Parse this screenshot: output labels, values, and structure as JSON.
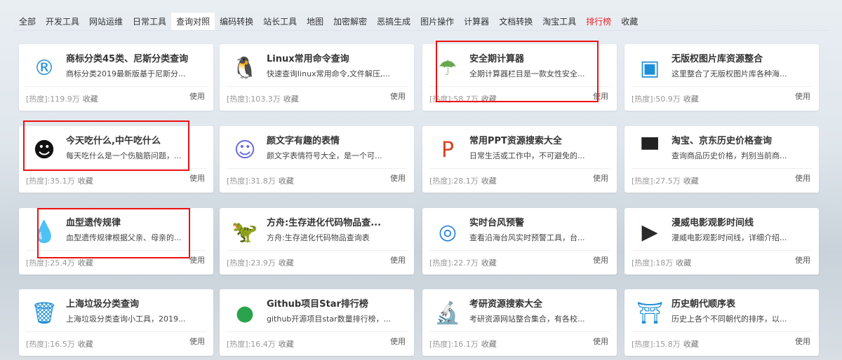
{
  "tabs": [
    "全部",
    "开发工具",
    "网站运维",
    "日常工具",
    "查询对照",
    "编码转换",
    "站长工具",
    "地图",
    "加密解密",
    "恶搞生成",
    "图片操作",
    "计算器",
    "文档转换",
    "淘宝工具",
    "排行榜",
    "收藏"
  ],
  "active_tab": "查询对照",
  "hot_tab": "排行榜",
  "heat_label": "[热度]:",
  "fav_label": "收藏",
  "use_label": "使用",
  "cards": [
    {
      "title": "商标分类45类、尼斯分类查询",
      "desc": "商标分类2019最新版基于尼斯分...",
      "heat": "119.9万",
      "icon": "registered-icon"
    },
    {
      "title": "Linux常用命令查询",
      "desc": "快速查询linux常用命令,文件解压,...",
      "heat": "103.3万",
      "icon": "penguin-icon"
    },
    {
      "title": "安全期计算器",
      "desc": "全期计算器栏目是一款女性安全...",
      "heat": "58.7万",
      "icon": "umbrella-icon"
    },
    {
      "title": "无版权图片库资源整合",
      "desc": "这里整合了无版权图片库各种海...",
      "heat": "50.9万",
      "icon": "image-icon"
    },
    {
      "title": "今天吃什么,中午吃什么",
      "desc": "每天吃什么是一个伤脑筋问题，...",
      "heat": "35.1万",
      "icon": "smiley-chef-icon"
    },
    {
      "title": "颜文字有趣的表情",
      "desc": "颜文字表情符号大全，是一个可...",
      "heat": "31.8万",
      "icon": "smiley-icon"
    },
    {
      "title": "常用PPT资源搜索大全",
      "desc": "日常生活或工作中，不可避免的...",
      "heat": "28.1万",
      "icon": "powerpoint-icon"
    },
    {
      "title": "淘宝、京东历史价格查询",
      "desc": "查询商品历史价格，判别当前商...",
      "heat": "27.5万",
      "icon": "tmall-cat-icon"
    },
    {
      "title": "血型遗传规律",
      "desc": "血型遗传规律根据父亲、母亲的...",
      "heat": "25.4万",
      "icon": "blood-drop-icon"
    },
    {
      "title": "方舟:生存进化代码物品查...",
      "desc": "方舟:生存进化代码物品查询表",
      "heat": "23.9万",
      "icon": "dinosaur-icon"
    },
    {
      "title": "实时台风预警",
      "desc": "查看沿海台风实时预警工具，台...",
      "heat": "22.7万",
      "icon": "typhoon-icon"
    },
    {
      "title": "漫威电影观影时间线",
      "desc": "漫威电影观影时间线，详细介绍...",
      "heat": "18万",
      "icon": "video-icon"
    },
    {
      "title": "上海垃圾分类查询",
      "desc": "上海垃圾分类查询小工具，2019...",
      "heat": "16.5万",
      "icon": "trash-bin-icon"
    },
    {
      "title": "Github项目Star排行榜",
      "desc": "github开源项目star数量排行榜，...",
      "heat": "16.4万",
      "icon": "github-icon"
    },
    {
      "title": "考研资源搜索大全",
      "desc": "考研资源网站整合集合，有各校...",
      "heat": "16.1万",
      "icon": "microscope-icon"
    },
    {
      "title": "历史朝代顺序表",
      "desc": "历史上各个不同朝代的排序，以...",
      "heat": "15.8万",
      "icon": "pagoda-icon"
    }
  ]
}
